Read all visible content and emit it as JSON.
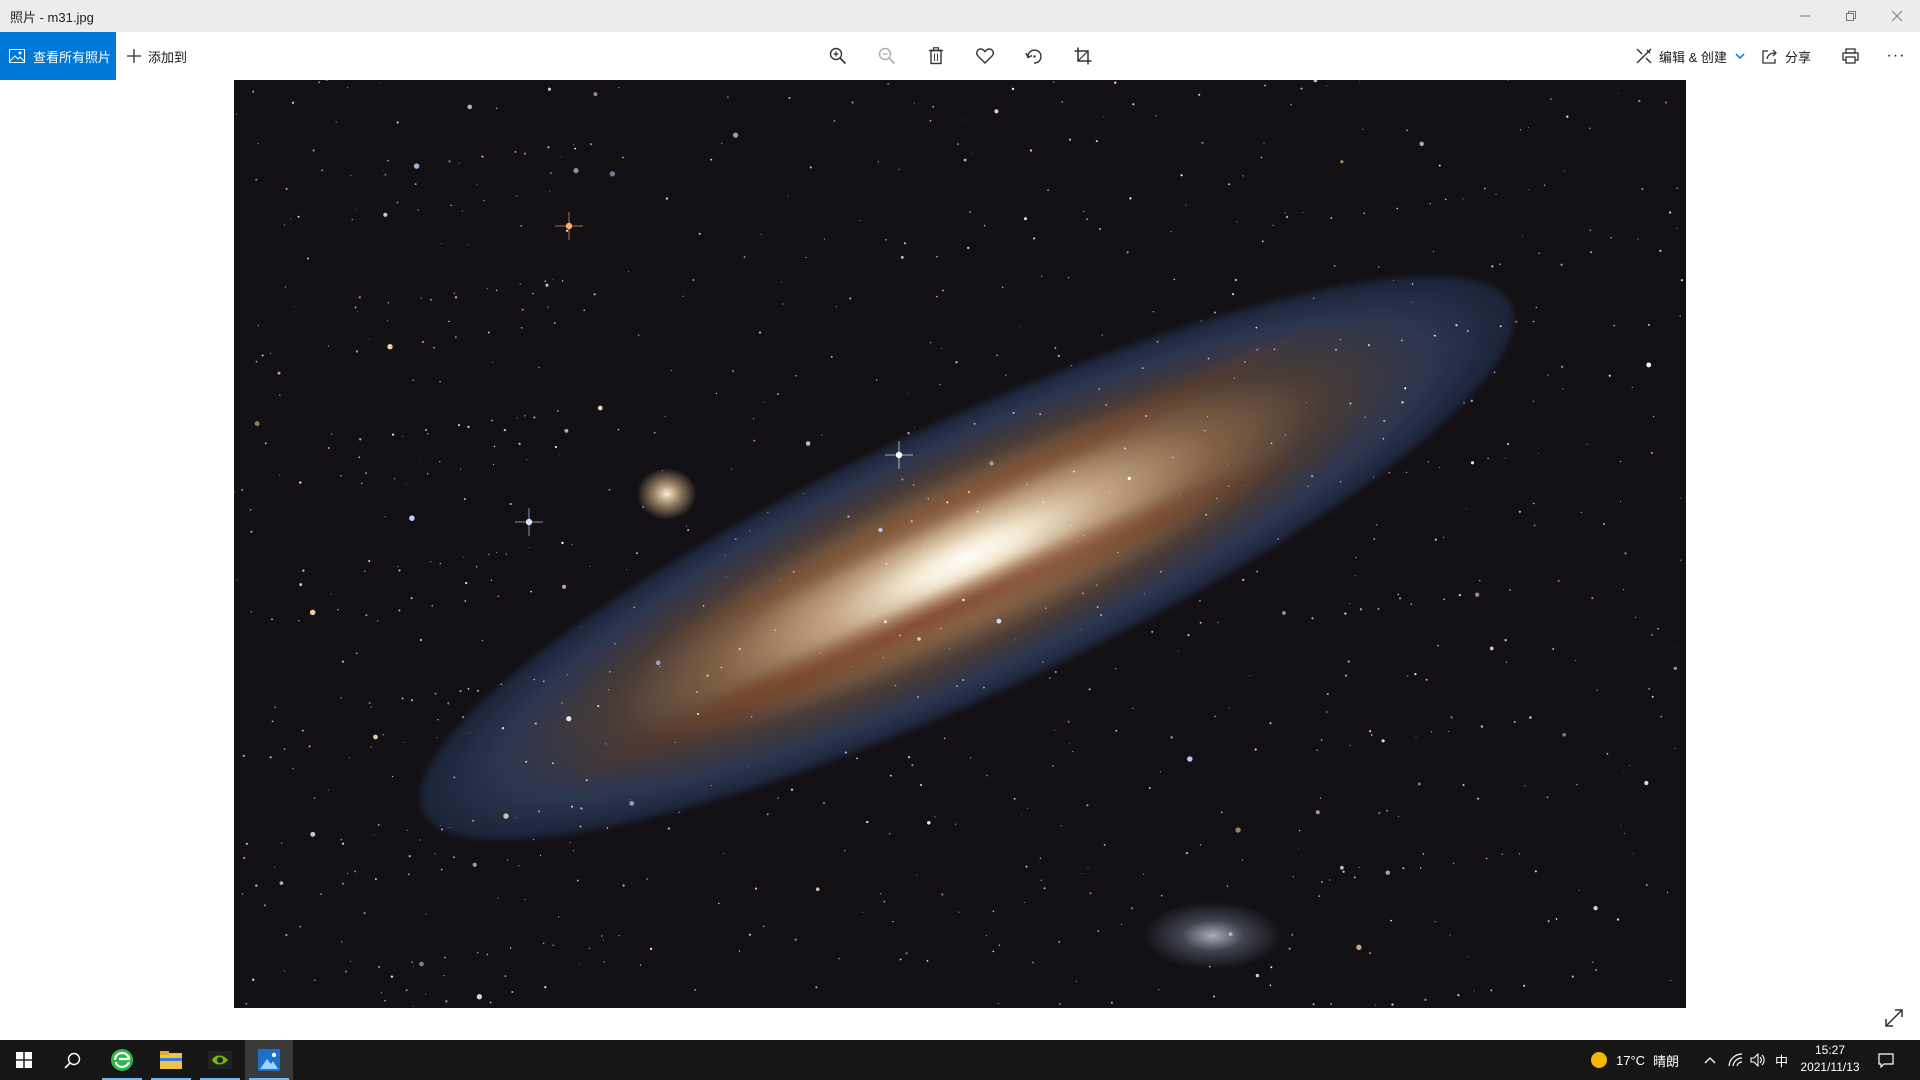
{
  "window": {
    "title": "照片 - m31.jpg",
    "controls": [
      "minimize-icon",
      "restore-icon",
      "close-icon"
    ]
  },
  "toolbar": {
    "view_all_label": "查看所有照片",
    "add_to_label": "添加到",
    "tools": [
      "zoom-in-icon",
      "zoom-out-icon",
      "delete-icon",
      "favorite-icon",
      "rotate-icon",
      "crop-icon"
    ],
    "edit_create_label": "编辑 & 创建",
    "share_label": "分享",
    "more_label": "···",
    "accent_color": "#0078d7"
  },
  "taskbar": {
    "apps": [
      "start-icon",
      "search-icon",
      "browser-icon",
      "file-explorer-icon",
      "nvidia-icon",
      "photos-icon"
    ],
    "weather_temp": "17°C",
    "weather_desc": "晴朗",
    "ime": "中",
    "time": "15:27",
    "date": "2021/11/13"
  }
}
